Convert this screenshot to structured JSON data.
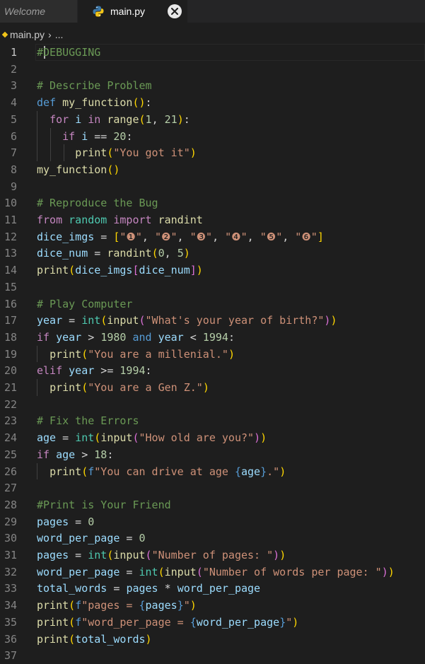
{
  "tabs": [
    {
      "label": "Welcome",
      "active": false
    },
    {
      "label": "main.py",
      "active": true,
      "icon": "python-icon"
    }
  ],
  "breadcrumb": {
    "file": "main.py",
    "more": "..."
  },
  "colors": {
    "background": "#1e1e1e",
    "comment": "#6a9955",
    "keyword": "#569cd6",
    "control": "#c586c0",
    "function": "#dcdcaa",
    "variable": "#9cdcfe",
    "number": "#b5cea8",
    "string": "#ce9178"
  },
  "editor": {
    "lines": [
      {
        "n": "1",
        "tokens": [
          [
            "c",
            "#"
          ],
          [
            "c",
            "DEBUGGING"
          ]
        ]
      },
      {
        "n": "2",
        "tokens": []
      },
      {
        "n": "3",
        "tokens": [
          [
            "c",
            "# Describe Problem"
          ]
        ]
      },
      {
        "n": "4",
        "tokens": [
          [
            "k",
            "def"
          ],
          [
            "o",
            " "
          ],
          [
            "f",
            "my_function"
          ],
          [
            "b1",
            "()"
          ],
          [
            "o",
            ":"
          ]
        ]
      },
      {
        "n": "5",
        "tokens": [
          [
            "o",
            "  "
          ],
          [
            "x",
            "for"
          ],
          [
            "o",
            " "
          ],
          [
            "v",
            "i"
          ],
          [
            "o",
            " "
          ],
          [
            "x",
            "in"
          ],
          [
            "o",
            " "
          ],
          [
            "f",
            "range"
          ],
          [
            "b1",
            "("
          ],
          [
            "n",
            "1"
          ],
          [
            "o",
            ", "
          ],
          [
            "n",
            "21"
          ],
          [
            "b1",
            ")"
          ],
          [
            "o",
            ":"
          ]
        ]
      },
      {
        "n": "6",
        "tokens": [
          [
            "o",
            "    "
          ],
          [
            "x",
            "if"
          ],
          [
            "o",
            " "
          ],
          [
            "v",
            "i"
          ],
          [
            "o",
            " == "
          ],
          [
            "n",
            "20"
          ],
          [
            "o",
            ":"
          ]
        ]
      },
      {
        "n": "7",
        "tokens": [
          [
            "o",
            "      "
          ],
          [
            "f",
            "print"
          ],
          [
            "b1",
            "("
          ],
          [
            "s",
            "\"You got it\""
          ],
          [
            "b1",
            ")"
          ]
        ]
      },
      {
        "n": "8",
        "tokens": [
          [
            "f",
            "my_function"
          ],
          [
            "b1",
            "()"
          ]
        ]
      },
      {
        "n": "9",
        "tokens": []
      },
      {
        "n": "10",
        "tokens": [
          [
            "c",
            "# Reproduce the Bug"
          ]
        ]
      },
      {
        "n": "11",
        "tokens": [
          [
            "x",
            "from"
          ],
          [
            "o",
            " "
          ],
          [
            "t",
            "random"
          ],
          [
            "o",
            " "
          ],
          [
            "x",
            "import"
          ],
          [
            "o",
            " "
          ],
          [
            "f",
            "randint"
          ]
        ]
      },
      {
        "n": "12",
        "tokens": [
          [
            "v",
            "dice_imgs"
          ],
          [
            "o",
            " = "
          ],
          [
            "b1",
            "["
          ],
          [
            "s",
            "\"❶\""
          ],
          [
            "o",
            ", "
          ],
          [
            "s",
            "\"❷\""
          ],
          [
            "o",
            ", "
          ],
          [
            "s",
            "\"❸\""
          ],
          [
            "o",
            ", "
          ],
          [
            "s",
            "\"❹\""
          ],
          [
            "o",
            ", "
          ],
          [
            "s",
            "\"❺\""
          ],
          [
            "o",
            ", "
          ],
          [
            "s",
            "\"❻\""
          ],
          [
            "b1",
            "]"
          ]
        ]
      },
      {
        "n": "13",
        "tokens": [
          [
            "v",
            "dice_num"
          ],
          [
            "o",
            " = "
          ],
          [
            "f",
            "randint"
          ],
          [
            "b1",
            "("
          ],
          [
            "n",
            "0"
          ],
          [
            "o",
            ", "
          ],
          [
            "n",
            "5"
          ],
          [
            "b1",
            ")"
          ]
        ]
      },
      {
        "n": "14",
        "tokens": [
          [
            "f",
            "print"
          ],
          [
            "b1",
            "("
          ],
          [
            "v",
            "dice_imgs"
          ],
          [
            "b2",
            "["
          ],
          [
            "v",
            "dice_num"
          ],
          [
            "b2",
            "]"
          ],
          [
            "b1",
            ")"
          ]
        ]
      },
      {
        "n": "15",
        "tokens": []
      },
      {
        "n": "16",
        "tokens": [
          [
            "c",
            "# Play Computer"
          ]
        ]
      },
      {
        "n": "17",
        "tokens": [
          [
            "v",
            "year"
          ],
          [
            "o",
            " = "
          ],
          [
            "t",
            "int"
          ],
          [
            "b1",
            "("
          ],
          [
            "f",
            "input"
          ],
          [
            "b2",
            "("
          ],
          [
            "s",
            "\"What's your year of birth?\""
          ],
          [
            "b2",
            ")"
          ],
          [
            "b1",
            ")"
          ]
        ]
      },
      {
        "n": "18",
        "tokens": [
          [
            "x",
            "if"
          ],
          [
            "o",
            " "
          ],
          [
            "v",
            "year"
          ],
          [
            "o",
            " > "
          ],
          [
            "n",
            "1980"
          ],
          [
            "o",
            " "
          ],
          [
            "k",
            "and"
          ],
          [
            "o",
            " "
          ],
          [
            "v",
            "year"
          ],
          [
            "o",
            " < "
          ],
          [
            "n",
            "1994"
          ],
          [
            "o",
            ":"
          ]
        ]
      },
      {
        "n": "19",
        "tokens": [
          [
            "o",
            "  "
          ],
          [
            "f",
            "print"
          ],
          [
            "b1",
            "("
          ],
          [
            "s",
            "\"You are a millenial.\""
          ],
          [
            "b1",
            ")"
          ]
        ]
      },
      {
        "n": "20",
        "tokens": [
          [
            "x",
            "elif"
          ],
          [
            "o",
            " "
          ],
          [
            "v",
            "year"
          ],
          [
            "o",
            " >= "
          ],
          [
            "n",
            "1994"
          ],
          [
            "o",
            ":"
          ]
        ]
      },
      {
        "n": "21",
        "tokens": [
          [
            "o",
            "  "
          ],
          [
            "f",
            "print"
          ],
          [
            "b1",
            "("
          ],
          [
            "s",
            "\"You are a Gen Z.\""
          ],
          [
            "b1",
            ")"
          ]
        ]
      },
      {
        "n": "22",
        "tokens": []
      },
      {
        "n": "23",
        "tokens": [
          [
            "c",
            "# Fix the Errors"
          ]
        ]
      },
      {
        "n": "24",
        "tokens": [
          [
            "v",
            "age"
          ],
          [
            "o",
            " = "
          ],
          [
            "t",
            "int"
          ],
          [
            "b1",
            "("
          ],
          [
            "f",
            "input"
          ],
          [
            "b2",
            "("
          ],
          [
            "s",
            "\"How old are you?\""
          ],
          [
            "b2",
            ")"
          ],
          [
            "b1",
            ")"
          ]
        ]
      },
      {
        "n": "25",
        "tokens": [
          [
            "x",
            "if"
          ],
          [
            "o",
            " "
          ],
          [
            "v",
            "age"
          ],
          [
            "o",
            " > "
          ],
          [
            "n",
            "18"
          ],
          [
            "o",
            ":"
          ]
        ]
      },
      {
        "n": "26",
        "tokens": [
          [
            "o",
            "  "
          ],
          [
            "f",
            "print"
          ],
          [
            "b1",
            "("
          ],
          [
            "k",
            "f"
          ],
          [
            "s",
            "\"You can drive at age "
          ],
          [
            "k",
            "{"
          ],
          [
            "v",
            "age"
          ],
          [
            "k",
            "}"
          ],
          [
            "s",
            ".\""
          ],
          [
            "b1",
            ")"
          ]
        ]
      },
      {
        "n": "27",
        "tokens": []
      },
      {
        "n": "28",
        "tokens": [
          [
            "c",
            "#Print is Your Friend"
          ]
        ]
      },
      {
        "n": "29",
        "tokens": [
          [
            "v",
            "pages"
          ],
          [
            "o",
            " = "
          ],
          [
            "n",
            "0"
          ]
        ]
      },
      {
        "n": "30",
        "tokens": [
          [
            "v",
            "word_per_page"
          ],
          [
            "o",
            " = "
          ],
          [
            "n",
            "0"
          ]
        ]
      },
      {
        "n": "31",
        "tokens": [
          [
            "v",
            "pages"
          ],
          [
            "o",
            " = "
          ],
          [
            "t",
            "int"
          ],
          [
            "b1",
            "("
          ],
          [
            "f",
            "input"
          ],
          [
            "b2",
            "("
          ],
          [
            "s",
            "\"Number of pages: \""
          ],
          [
            "b2",
            ")"
          ],
          [
            "b1",
            ")"
          ]
        ]
      },
      {
        "n": "32",
        "tokens": [
          [
            "v",
            "word_per_page"
          ],
          [
            "o",
            " = "
          ],
          [
            "t",
            "int"
          ],
          [
            "b1",
            "("
          ],
          [
            "f",
            "input"
          ],
          [
            "b2",
            "("
          ],
          [
            "s",
            "\"Number of words per page: \""
          ],
          [
            "b2",
            ")"
          ],
          [
            "b1",
            ")"
          ]
        ]
      },
      {
        "n": "33",
        "tokens": [
          [
            "v",
            "total_words"
          ],
          [
            "o",
            " = "
          ],
          [
            "v",
            "pages"
          ],
          [
            "o",
            " * "
          ],
          [
            "v",
            "word_per_page"
          ]
        ]
      },
      {
        "n": "34",
        "tokens": [
          [
            "f",
            "print"
          ],
          [
            "b1",
            "("
          ],
          [
            "k",
            "f"
          ],
          [
            "s",
            "\"pages = "
          ],
          [
            "k",
            "{"
          ],
          [
            "v",
            "pages"
          ],
          [
            "k",
            "}"
          ],
          [
            "s",
            "\""
          ],
          [
            "b1",
            ")"
          ]
        ]
      },
      {
        "n": "35",
        "tokens": [
          [
            "f",
            "print"
          ],
          [
            "b1",
            "("
          ],
          [
            "k",
            "f"
          ],
          [
            "s",
            "\"word_per_page = "
          ],
          [
            "k",
            "{"
          ],
          [
            "v",
            "word_per_page"
          ],
          [
            "k",
            "}"
          ],
          [
            "s",
            "\""
          ],
          [
            "b1",
            ")"
          ]
        ]
      },
      {
        "n": "36",
        "tokens": [
          [
            "f",
            "print"
          ],
          [
            "b1",
            "("
          ],
          [
            "v",
            "total_words"
          ],
          [
            "b1",
            ")"
          ]
        ]
      },
      {
        "n": "37",
        "tokens": []
      }
    ]
  }
}
